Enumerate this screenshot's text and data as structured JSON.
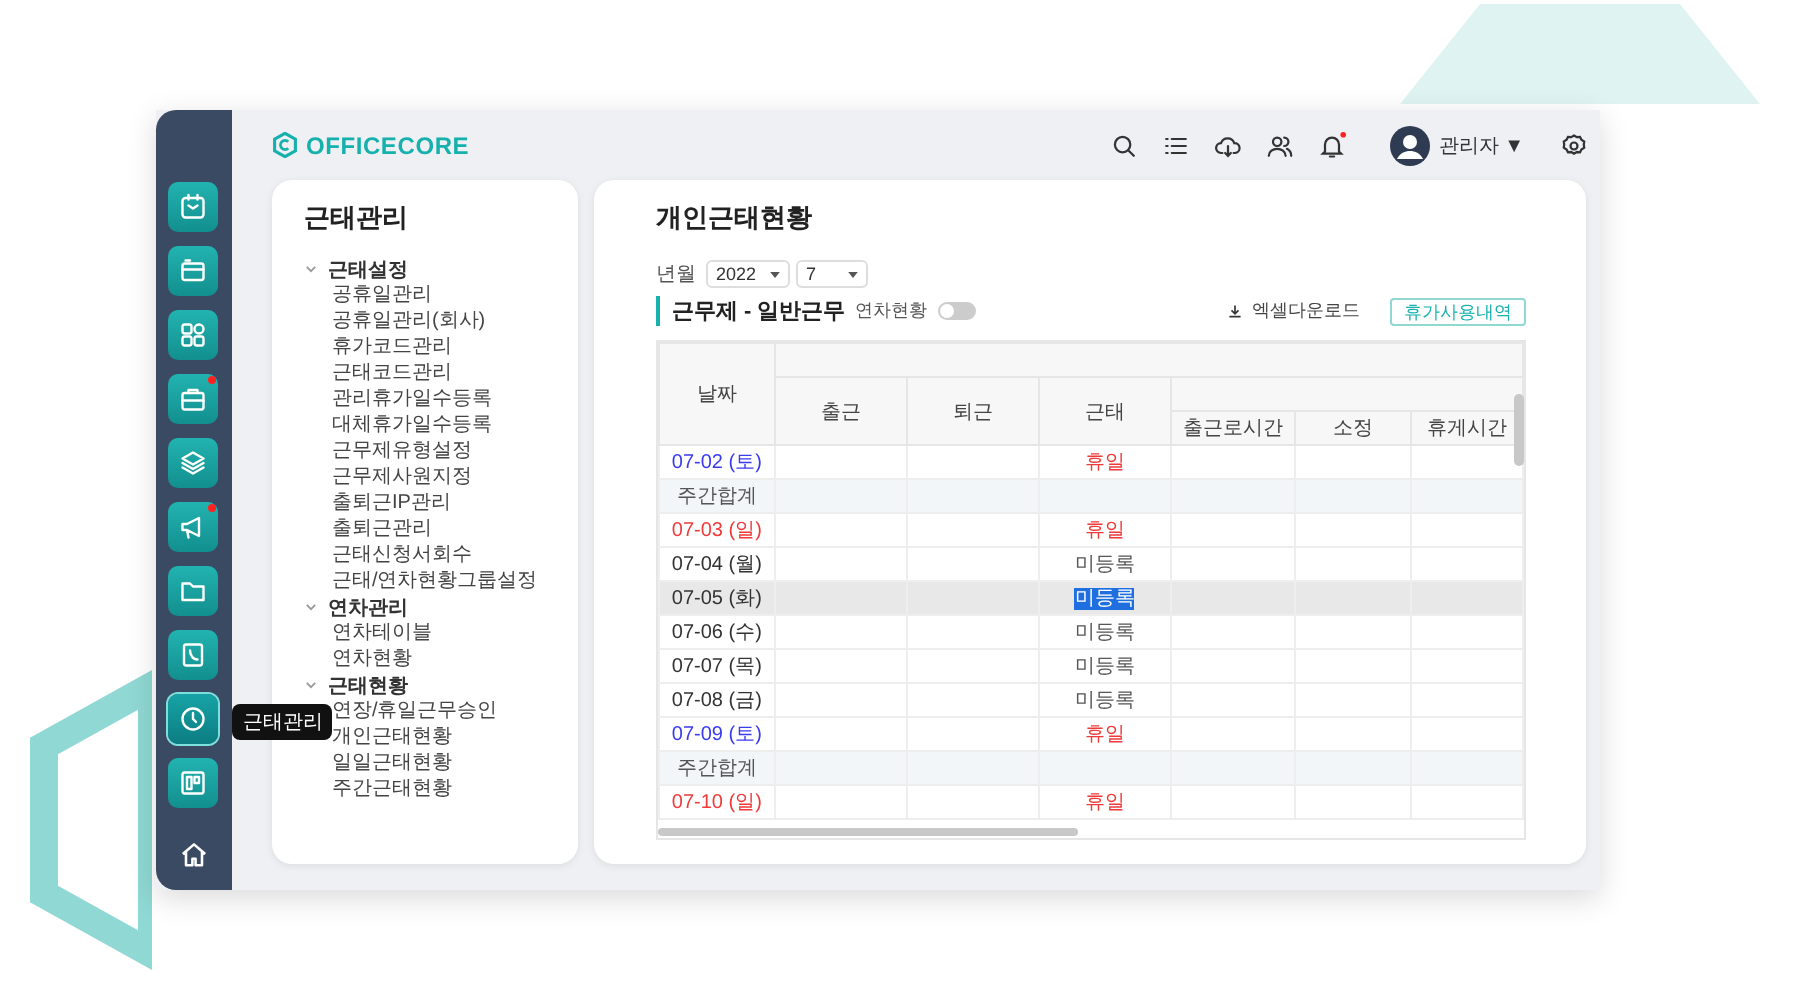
{
  "sidebar": {
    "items": [
      {
        "badge": false,
        "selected": false
      },
      {
        "badge": false,
        "selected": false
      },
      {
        "badge": false,
        "selected": false
      },
      {
        "badge": true,
        "selected": false
      },
      {
        "badge": false,
        "selected": false
      },
      {
        "badge": true,
        "selected": false
      },
      {
        "badge": false,
        "selected": false
      },
      {
        "badge": false,
        "selected": false
      },
      {
        "badge": false,
        "selected": true,
        "tooltip": "근태관리"
      },
      {
        "badge": false,
        "selected": false
      }
    ]
  },
  "header": {
    "logo": "OFFICECORE",
    "icons": [
      {
        "badge": false
      },
      {
        "badge": false
      },
      {
        "badge": false
      },
      {
        "badge": false
      },
      {
        "badge": true
      }
    ],
    "user": {
      "name": "관리자",
      "caret": "▼"
    }
  },
  "menu": {
    "title": "근태관리",
    "groups": [
      {
        "label": "근태설정",
        "expanded": true,
        "children": [
          {
            "label": "공휴일관리"
          },
          {
            "label": "공휴일관리(회사)"
          },
          {
            "label": "휴가코드관리"
          },
          {
            "label": "근태코드관리"
          },
          {
            "label": "관리휴가일수등록"
          },
          {
            "label": "대체휴가일수등록"
          },
          {
            "label": "근무제유형설정"
          },
          {
            "label": "근무제사원지정"
          },
          {
            "label": "출퇴근IP관리"
          },
          {
            "label": "출퇴근관리"
          },
          {
            "label": "근태신청서회수"
          },
          {
            "label": "근태/연차현황그룹설정"
          }
        ]
      },
      {
        "label": "연차관리",
        "expanded": true,
        "children": [
          {
            "label": "연차테이블"
          },
          {
            "label": "연차현황"
          }
        ]
      },
      {
        "label": "근태현황",
        "expanded": true,
        "children": [
          {
            "label": "연장/휴일근무승인"
          },
          {
            "label": "개인근태현황"
          },
          {
            "label": "일일근태현황"
          },
          {
            "label": "주간근태현황"
          }
        ]
      }
    ]
  },
  "page": {
    "title": "개인근태현황",
    "filter": {
      "label": "년월",
      "year": "2022",
      "month": "7"
    },
    "section": {
      "title": "근무제 - 일반근무",
      "toggle": {
        "label": "연차현황",
        "on": false
      },
      "download": "엑셀다운로드",
      "button": "휴가사용내역"
    },
    "table": {
      "columns": [
        "날짜",
        "출근",
        "퇴근",
        "근태",
        "출근로시간",
        "소정",
        "휴게시간"
      ],
      "rows": [
        {
          "kind": "saturday",
          "date": "07-02 (토)",
          "status": "휴일",
          "highlighted": false
        },
        {
          "kind": "subtotal",
          "date": "주간합계",
          "highlighted": false
        },
        {
          "kind": "sunday",
          "date": "07-03 (일)",
          "status": "휴일",
          "highlighted": false
        },
        {
          "kind": "weekday",
          "date": "07-04 (월)",
          "status": "미등록",
          "highlighted": false
        },
        {
          "kind": "weekday",
          "date": "07-05 (화)",
          "status": "미등록",
          "highlighted": true
        },
        {
          "kind": "weekday",
          "date": "07-06 (수)",
          "status": "미등록",
          "highlighted": false
        },
        {
          "kind": "weekday",
          "date": "07-07 (목)",
          "status": "미등록",
          "highlighted": false
        },
        {
          "kind": "weekday",
          "date": "07-08 (금)",
          "status": "미등록",
          "highlighted": false
        },
        {
          "kind": "saturday",
          "date": "07-09 (토)",
          "status": "휴일",
          "highlighted": false
        },
        {
          "kind": "subtotal",
          "date": "주간합계",
          "highlighted": false
        },
        {
          "kind": "sunday",
          "date": "07-10 (일)",
          "status": "휴일",
          "highlighted": false
        }
      ]
    }
  }
}
